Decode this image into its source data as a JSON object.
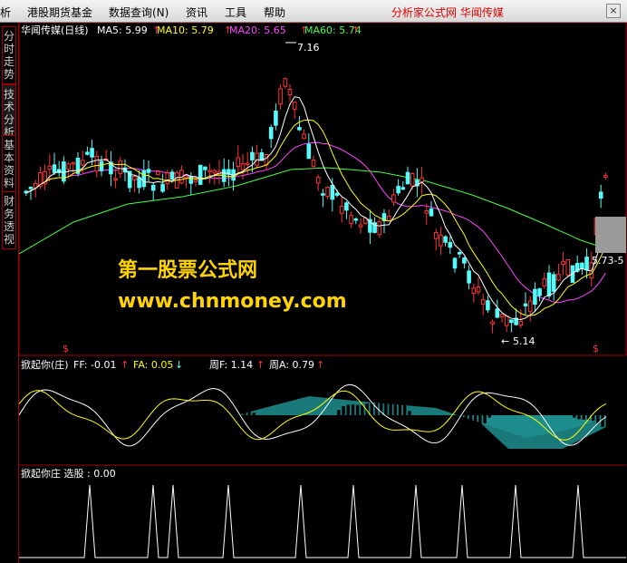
{
  "menubar": {
    "items": [
      "析",
      "港股期货基金",
      "数据查询(N)",
      "资讯",
      "工具",
      "帮助"
    ],
    "brand": "分析家公式网  华闻传媒",
    "close": "×"
  },
  "sidetabs": [
    "分时走势",
    "技术分析",
    "基本资料",
    "财务透视"
  ],
  "main_panel": {
    "title": "华闻传媒(日线)",
    "ma": [
      {
        "label": "MA5: 5.99",
        "color": "#ffffff"
      },
      {
        "label": "MA10: 5.79",
        "color": "#ffff00"
      },
      {
        "label": "MA20: 5.65",
        "color": "#ff44ff"
      },
      {
        "label": "MA60: 5.74",
        "color": "#44ff44"
      }
    ],
    "high_label": "7.16",
    "low_label": "5.14",
    "right_label": "5.73-5",
    "signal_marks": [
      "$",
      "$"
    ]
  },
  "watermark": {
    "line1": "第一股票公式网",
    "line2": "www.chnmoney.com"
  },
  "indicator1": {
    "name": "掀起你(庄)",
    "values": [
      {
        "label": "FF: -0.01",
        "color": "#ffffff"
      },
      {
        "label": "FA: 0.05",
        "color": "#ffff00"
      },
      {
        "label": "周F: 1.14",
        "color": "#ffffff"
      },
      {
        "label": "周A: 0.79",
        "color": "#ffffff"
      }
    ]
  },
  "indicator2": {
    "name": "掀起你庄 选股 : 0.00"
  },
  "colors": {
    "up": "#ff3333",
    "down": "#54fcfc",
    "ma5": "#ffffff",
    "ma10": "#ffff00",
    "ma20": "#ff44ff",
    "ma60": "#44ff44",
    "grid": "#a00000"
  }
}
